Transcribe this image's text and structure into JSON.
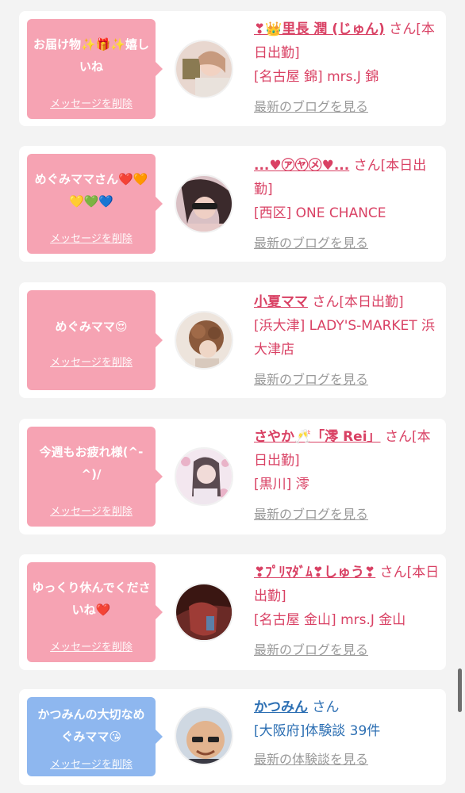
{
  "cards": [
    {
      "message": "お届け物✨🎁✨嬉しいね",
      "delete_label": "メッセージを削除",
      "name": "❣👑里長 潤 (じゅん)",
      "san": "さん",
      "status": "[本日出勤]",
      "location": "[名古屋 錦] mrs.J 錦",
      "blog_link": "最新のブログを見る"
    },
    {
      "message": "めぐみママさん❤️🧡💛💚💙",
      "delete_label": "メッセージを削除",
      "name": "...♥㋐㋳㋱♥...",
      "san": "さん",
      "status": "[本日出勤]",
      "location": "[西区] ONE CHANCE",
      "blog_link": "最新のブログを見る"
    },
    {
      "message": "めぐみママ😍",
      "delete_label": "メッセージを削除",
      "name": "小夏ママ",
      "san": "さん",
      "status": "[本日出勤]",
      "location": "[浜大津] LADY'S-MARKET 浜大津店",
      "blog_link": "最新のブログを見る"
    },
    {
      "message": "今週もお疲れ様(^-^)/",
      "delete_label": "メッセージを削除",
      "name": "さやか🥂「澪 Rei」",
      "san": "さん",
      "status": "[本日出勤]",
      "location": "[黒川] 澪",
      "blog_link": "最新のブログを見る"
    },
    {
      "message": "ゆっくり休んでくださいね❤️",
      "delete_label": "メッセージを削除",
      "name": "❣ﾌﾟﾘﾏﾀﾞﾑ❣しゅう❣",
      "san": "さん",
      "status": "[本日出勤]",
      "location": "[名古屋 金山] mrs.J 金山",
      "blog_link": "最新のブログを見る"
    },
    {
      "message": "かつみんの大切なめぐみママ😘",
      "delete_label": "メッセージを削除",
      "name": "かつみん",
      "san": "さん",
      "status": "",
      "location": "[大阪府]体験談 39件",
      "blog_link": "最新の体験談を見る"
    }
  ],
  "colors": {
    "pink_bubble": "#f6a3b3",
    "blue_bubble": "#8eb7ef",
    "pink_text": "#d94164",
    "blue_text": "#2c6fb3"
  }
}
